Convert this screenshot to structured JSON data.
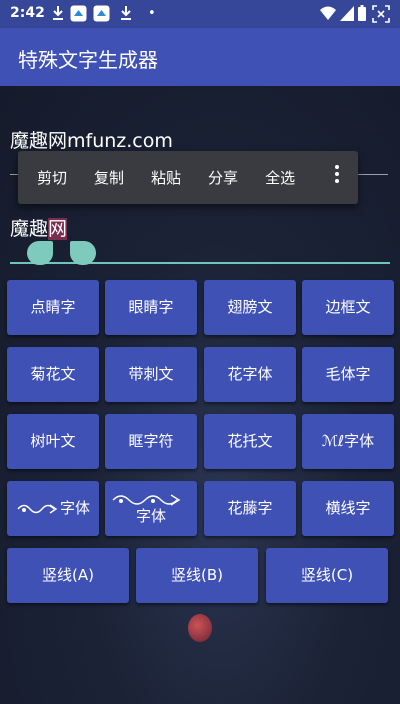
{
  "status_bar": {
    "time": "2:42",
    "notification_dot": "•",
    "icons": [
      "download-icon",
      "app-notification-icon",
      "app-notification-icon",
      "download-icon",
      "wifi-icon",
      "signal-icon",
      "battery-icon",
      "screenshot-icon"
    ]
  },
  "app_bar": {
    "title": "特殊文字生成器"
  },
  "input": {
    "value": "魔趣网mfunz.com"
  },
  "context_menu": {
    "items": [
      "剪切",
      "复制",
      "粘贴",
      "分享",
      "全选"
    ],
    "more_icon": "more-vertical-icon"
  },
  "output": {
    "prefix": "魔趣",
    "selected": "网"
  },
  "buttons": [
    [
      "点睛字",
      "眼睛字",
      "翅膀文",
      "边框文"
    ],
    [
      "菊花文",
      "带刺文",
      "花字体",
      "毛体字"
    ],
    [
      "树叶文",
      "眶字符",
      "花托文",
      "ℳℓ字体"
    ],
    [
      "字体",
      "字体",
      "花藤字",
      "横线字"
    ]
  ],
  "wide_buttons": [
    "竖线(A)",
    "竖线(B)",
    "竖线(C)"
  ],
  "colors": {
    "status_bar": "#36479a",
    "app_bar": "#3f51b5",
    "button": "#3f51b5",
    "accent": "#6ec6b8",
    "selection": "#7a2e4e"
  }
}
